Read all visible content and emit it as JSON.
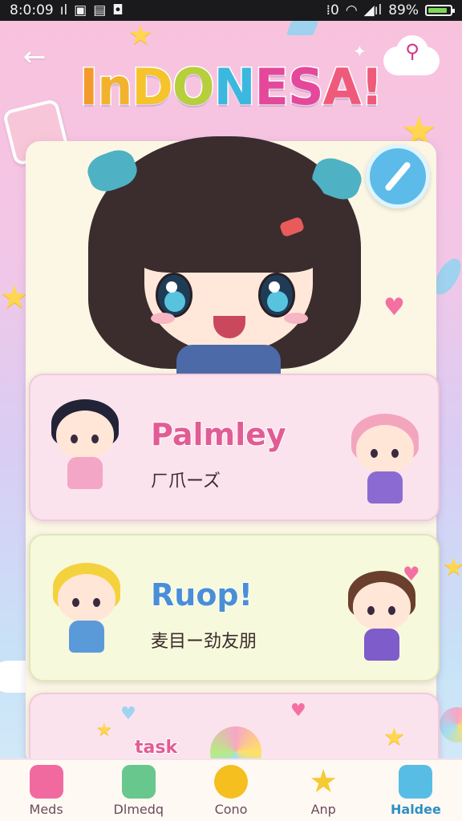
{
  "status_bar": {
    "time": "8:0:09",
    "left_icons": [
      "vertical-bar-icon",
      "image-icon",
      "notification-icon",
      "lock-icon"
    ],
    "right_icons": [
      "vibrate-icon",
      "wifi-icon",
      "signal-icon"
    ],
    "battery": "89%",
    "battery_level": 0.89
  },
  "header": {
    "title": "INDONESA!",
    "title_letters": [
      {
        "ch": "I",
        "color": "#f39a2d"
      },
      {
        "ch": "n",
        "color": "#f3b22d"
      },
      {
        "ch": "D",
        "color": "#f6c32b"
      },
      {
        "ch": "O",
        "color": "#b6cf3b"
      },
      {
        "ch": "N",
        "color": "#3bb7e0"
      },
      {
        "ch": "E",
        "color": "#e5489b"
      },
      {
        "ch": "S",
        "color": "#e5489b"
      },
      {
        "ch": "A",
        "color": "#f05a7a"
      },
      {
        "ch": "!",
        "color": "#f05a7a"
      }
    ]
  },
  "rows": [
    {
      "title": "Palmley",
      "subtitle": "ㄏ爪ーズ",
      "title_color": "#e15c95"
    },
    {
      "title": "Ruop!",
      "subtitle": "麦目ー劲友朋",
      "title_color": "#4a8fd6"
    },
    {
      "title": "task",
      "subtitle": ""
    }
  ],
  "nav": {
    "items": [
      {
        "label": "Meds",
        "icon": "cupcake-icon",
        "color": "#f06aa0"
      },
      {
        "label": "Dlmedq",
        "icon": "cup-icon",
        "color": "#68c78c"
      },
      {
        "label": "Cono",
        "icon": "coin-icon",
        "color": "#f5bf1f"
      },
      {
        "label": "Anp",
        "icon": "star-icon",
        "color": "#f7c933"
      },
      {
        "label": "Haldee",
        "icon": "tooth-icon",
        "color": "#58bde4"
      }
    ],
    "active_index": 4
  },
  "colors": {
    "accent_blue": "#5cbbe9",
    "accent_pink": "#e15c95",
    "card_cream": "#fbf7e4"
  }
}
